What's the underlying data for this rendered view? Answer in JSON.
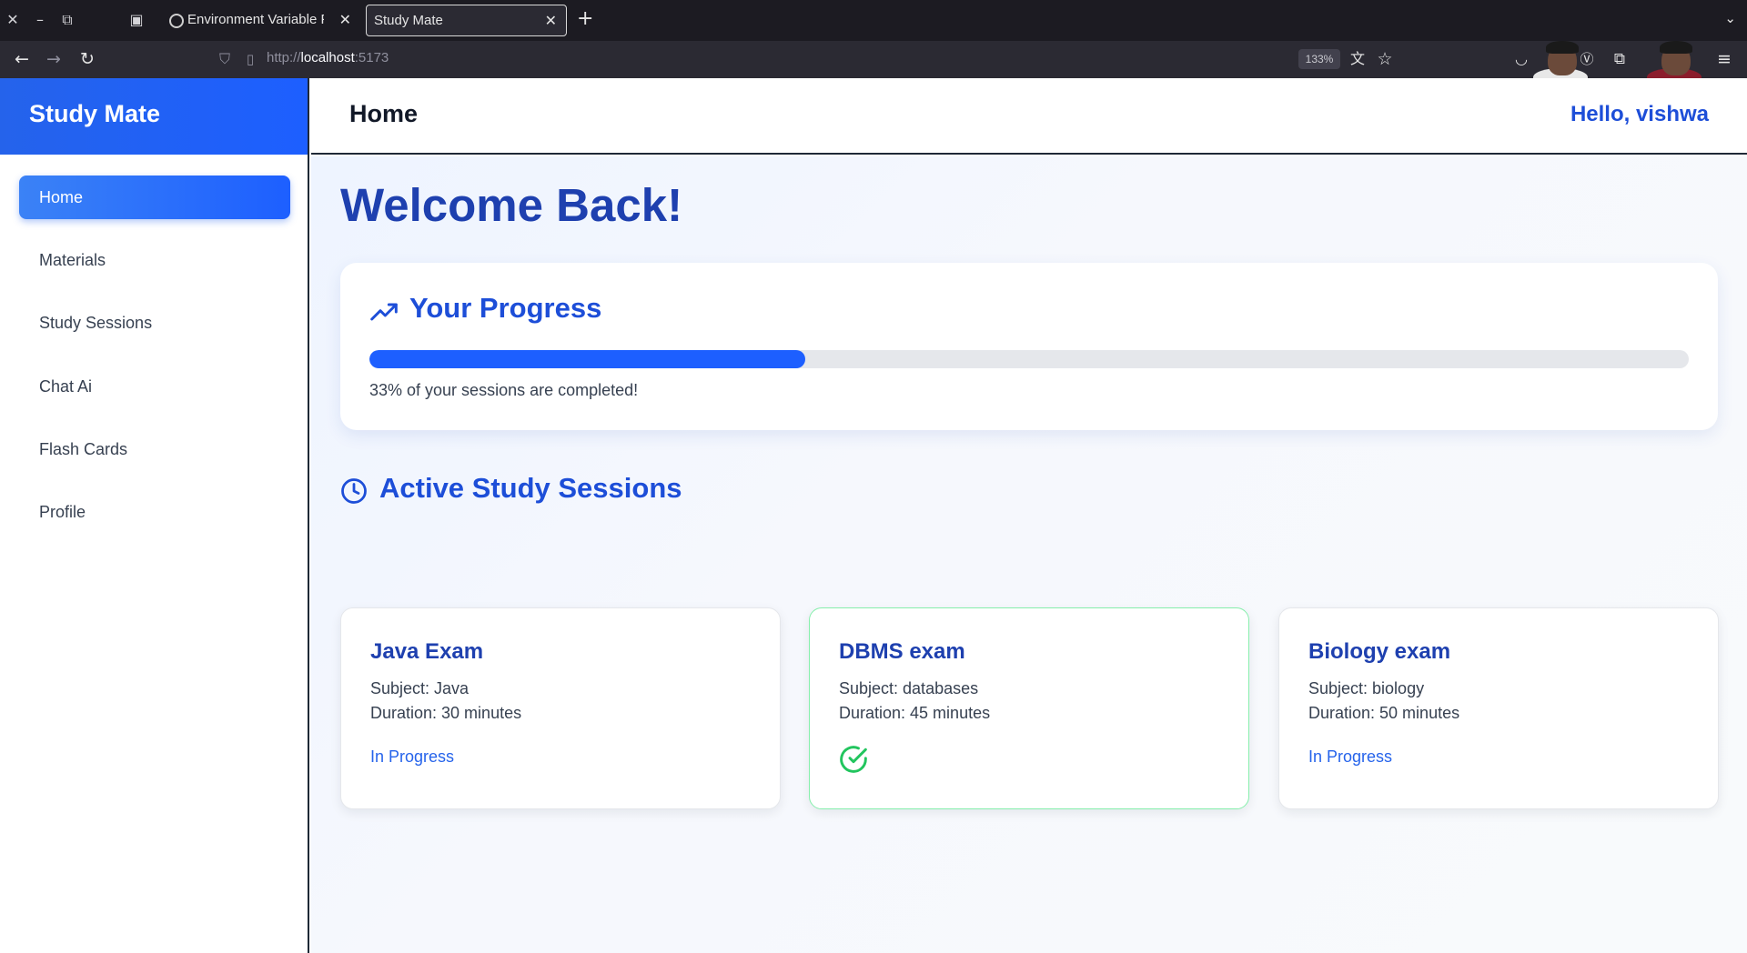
{
  "browser": {
    "tabs": [
      {
        "title": "Environment Variable Pla"
      },
      {
        "title": "Study Mate"
      }
    ],
    "url_scheme": "http://",
    "url_host": "localhost",
    "url_port": ":5173",
    "zoom": "133%"
  },
  "app": {
    "brand": "Study Mate",
    "nav": [
      {
        "label": "Home",
        "active": true
      },
      {
        "label": "Materials",
        "active": false
      },
      {
        "label": "Study Sessions",
        "active": false
      },
      {
        "label": "Chat Ai",
        "active": false
      },
      {
        "label": "Flash Cards",
        "active": false
      },
      {
        "label": "Profile",
        "active": false
      }
    ],
    "header": {
      "title": "Home",
      "greeting": "Hello, vishwa"
    }
  },
  "main": {
    "welcome": "Welcome Back!",
    "progress": {
      "title": "Your Progress",
      "fraction": 0.33,
      "text": "33% of your sessions are completed!"
    },
    "sessions": {
      "title": "Active Study Sessions",
      "items": [
        {
          "title": "Java Exam",
          "subject": "Subject: Java",
          "duration": "Duration: 30 minutes",
          "status": "In Progress",
          "completed": false
        },
        {
          "title": "DBMS exam",
          "subject": "Subject: databases",
          "duration": "Duration: 45 minutes",
          "status": "",
          "completed": true
        },
        {
          "title": "Biology exam",
          "subject": "Subject: biology",
          "duration": "Duration: 50 minutes",
          "status": "In Progress",
          "completed": false
        }
      ]
    }
  },
  "colors": {
    "accent": "#1d5fff",
    "heading": "#1e40af",
    "success": "#22c55e"
  },
  "icons": {
    "progress": "trending-up-icon",
    "sessions": "clock-icon",
    "completed": "check-circle-icon"
  }
}
